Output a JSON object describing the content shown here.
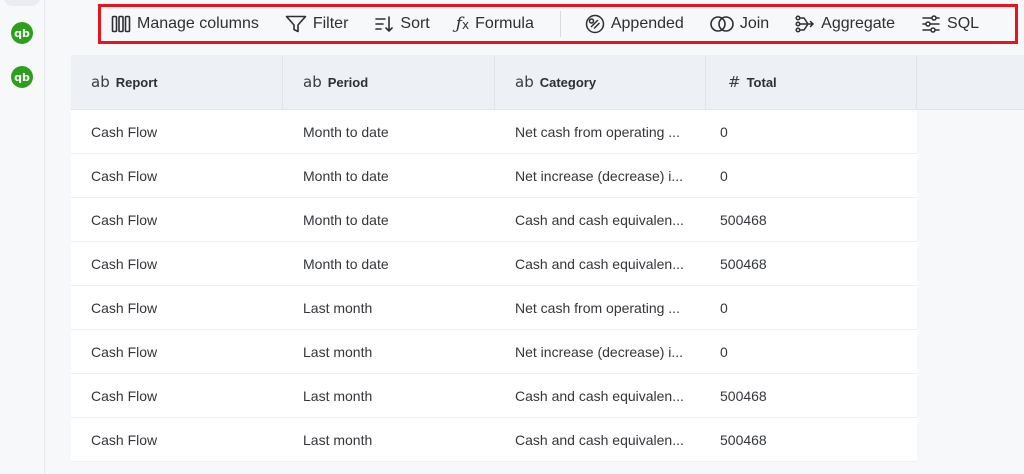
{
  "sidebar": {
    "connections": [
      {
        "icon": "quickbooks-icon",
        "label": "qb"
      },
      {
        "icon": "quickbooks-icon",
        "label": "qb"
      }
    ]
  },
  "toolbar": {
    "manage_columns": "Manage columns",
    "filter": "Filter",
    "sort": "Sort",
    "formula": "Formula",
    "appended": "Appended",
    "join": "Join",
    "aggregate": "Aggregate",
    "sql": "SQL"
  },
  "table": {
    "columns": [
      {
        "type_glyph": "ab",
        "label": "Report"
      },
      {
        "type_glyph": "ab",
        "label": "Period"
      },
      {
        "type_glyph": "ab",
        "label": "Category"
      },
      {
        "type_glyph": "#",
        "label": "Total"
      }
    ],
    "rows": [
      [
        "Cash Flow",
        "Month to date",
        "Net cash from operating ...",
        "0"
      ],
      [
        "Cash Flow",
        "Month to date",
        "Net increase (decrease) i...",
        "0"
      ],
      [
        "Cash Flow",
        "Month to date",
        "Cash and cash equivalen...",
        "500468"
      ],
      [
        "Cash Flow",
        "Month to date",
        "Cash and cash equivalen...",
        "500468"
      ],
      [
        "Cash Flow",
        "Last month",
        "Net cash from operating ...",
        "0"
      ],
      [
        "Cash Flow",
        "Last month",
        "Net increase (decrease) i...",
        "0"
      ],
      [
        "Cash Flow",
        "Last month",
        "Cash and cash equivalen...",
        "500468"
      ],
      [
        "Cash Flow",
        "Last month",
        "Cash and cash equivalen...",
        "500468"
      ]
    ]
  },
  "colors": {
    "highlight_border": "#e8131f",
    "quickbooks_green": "#2ca01c"
  }
}
